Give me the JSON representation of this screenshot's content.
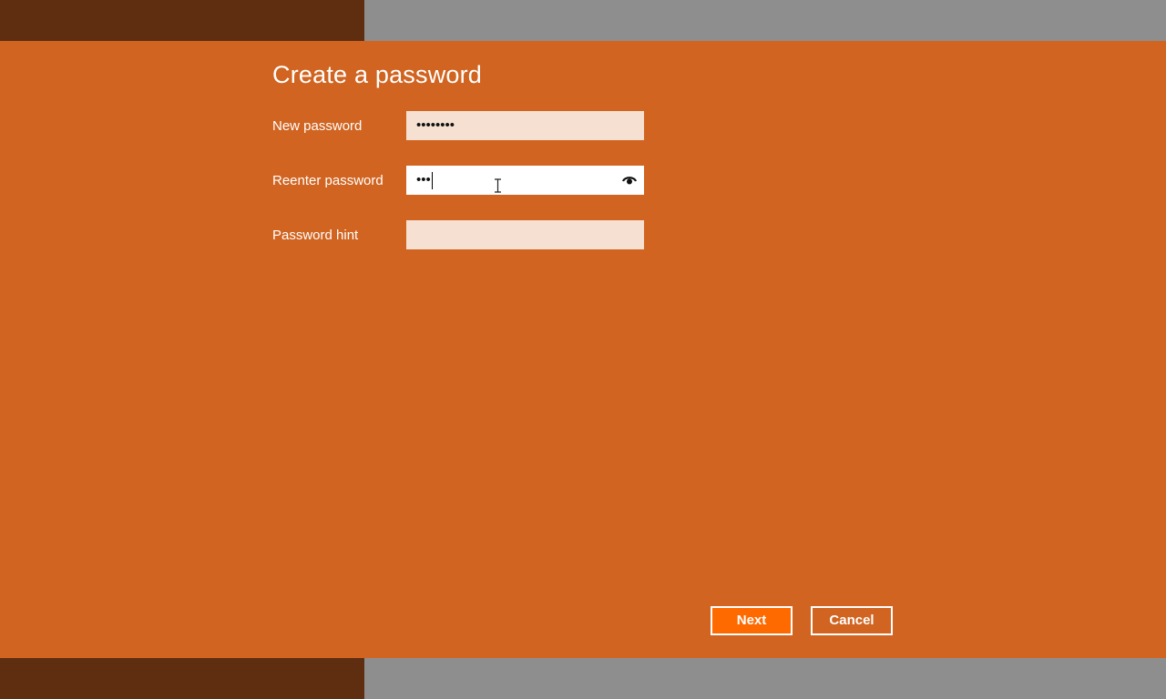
{
  "dialog": {
    "title": "Create a password",
    "fields": [
      {
        "label": "New password",
        "value": "••••••••"
      },
      {
        "label": "Reenter password",
        "value": "•••"
      },
      {
        "label": "Password hint",
        "value": ""
      }
    ],
    "reveal_icon": "eye-icon",
    "buttons": {
      "next": "Next",
      "cancel": "Cancel"
    }
  },
  "colors": {
    "dialog_bg": "#d06420",
    "accent_strip": "#5f2e10",
    "backdrop": "#8e8e8e",
    "field_bg": "#f6e0d2",
    "next_button": "#ff6a00"
  }
}
